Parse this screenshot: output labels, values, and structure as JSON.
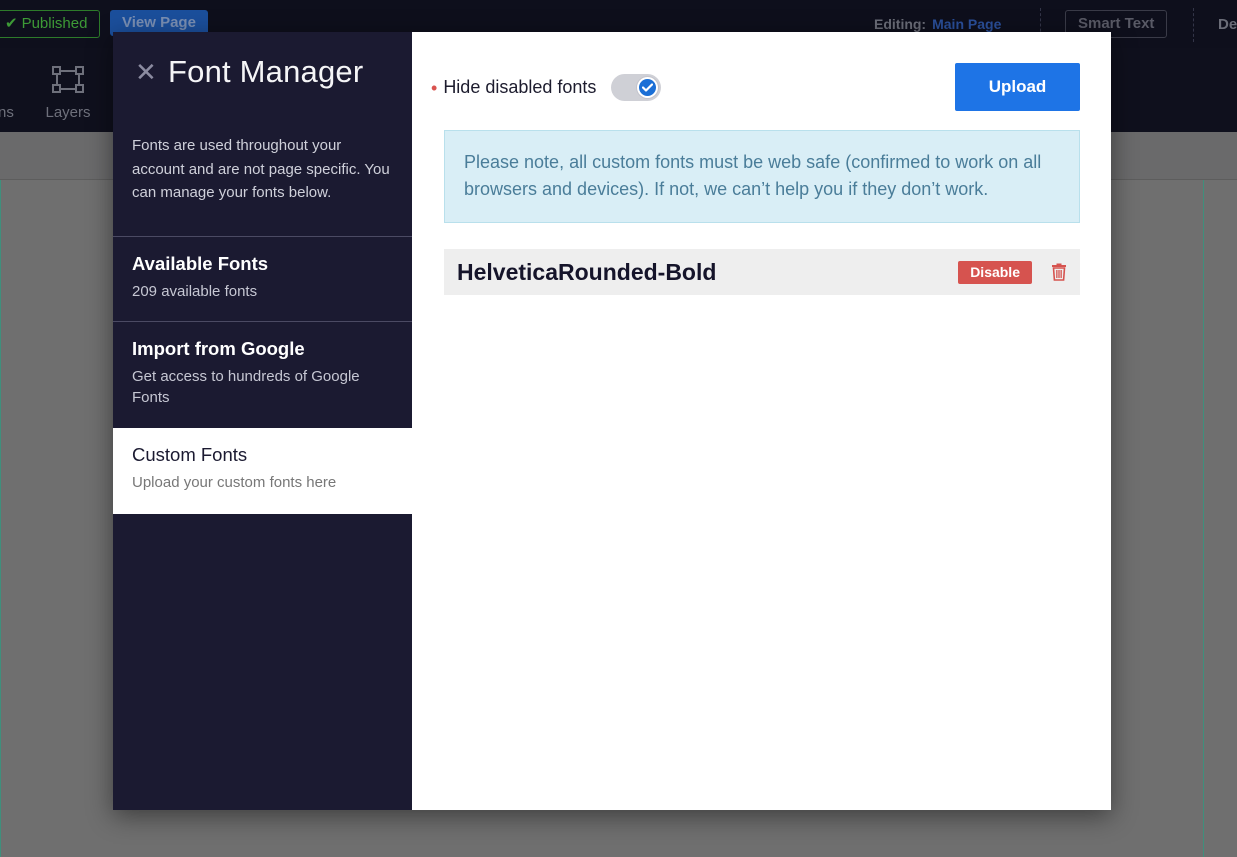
{
  "app": {
    "published_label": "Published",
    "view_page_label": "View Page",
    "editing_label": "Editing:",
    "editing_page": "Main Page",
    "smart_text_label": "Smart Text",
    "right_cut_label": "De",
    "toolbar_partial_label": "ns",
    "layers_label": "Layers"
  },
  "modal": {
    "title": "Font Manager",
    "description": "Fonts are used throughout your account and are not page specific. You can manage your fonts below.",
    "nav": [
      {
        "title": "Available Fonts",
        "subtitle": "209 available fonts",
        "active": false
      },
      {
        "title": "Import from Google",
        "subtitle": "Get access to hundreds of Google Fonts",
        "active": false
      },
      {
        "title": "Custom Fonts",
        "subtitle": "Upload your custom fonts here",
        "active": true
      }
    ],
    "hide_disabled_label": "Hide disabled fonts",
    "hide_disabled_checked": true,
    "upload_label": "Upload",
    "notice": "Please note, all custom fonts must be web safe (confirmed to work on all browsers and devices). If not, we can’t help you if they don’t work.",
    "fonts": [
      {
        "name": "HelveticaRounded-Bold",
        "action_label": "Disable"
      }
    ]
  },
  "colors": {
    "sidebar_bg": "#1b1a31",
    "accent": "#1e74e6",
    "danger": "#d6534f",
    "notice_bg": "#d9eef6"
  }
}
